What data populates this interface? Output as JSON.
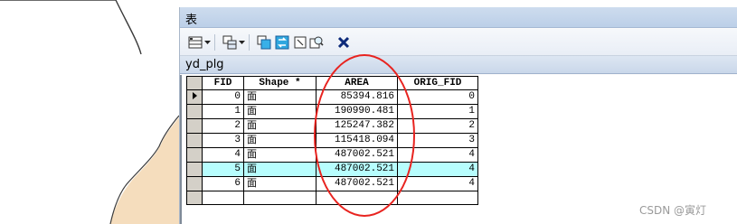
{
  "window": {
    "title": "表"
  },
  "toolbar": {
    "icons": [
      "table-options-icon",
      "related-tables-icon",
      "select-by-attributes-icon",
      "switch-selection-icon",
      "clear-selection-icon",
      "zoom-to-selected-icon",
      "delete-selected-icon"
    ]
  },
  "table": {
    "name": "yd_plg",
    "columns": [
      "FID",
      "Shape *",
      "AREA",
      "ORIG_FID"
    ],
    "rows": [
      {
        "fid": "0",
        "shape": "面",
        "area": "85394.816",
        "orig_fid": "0",
        "current": true,
        "highlighted": false
      },
      {
        "fid": "1",
        "shape": "面",
        "area": "190990.481",
        "orig_fid": "1",
        "current": false,
        "highlighted": false
      },
      {
        "fid": "2",
        "shape": "面",
        "area": "125247.382",
        "orig_fid": "2",
        "current": false,
        "highlighted": false
      },
      {
        "fid": "3",
        "shape": "面",
        "area": "115418.094",
        "orig_fid": "3",
        "current": false,
        "highlighted": false
      },
      {
        "fid": "4",
        "shape": "面",
        "area": "487002.521",
        "orig_fid": "4",
        "current": false,
        "highlighted": false
      },
      {
        "fid": "5",
        "shape": "面",
        "area": "487002.521",
        "orig_fid": "4",
        "current": false,
        "highlighted": true
      },
      {
        "fid": "6",
        "shape": "面",
        "area": "487002.521",
        "orig_fid": "4",
        "current": false,
        "highlighted": false
      }
    ]
  },
  "colors": {
    "highlight_row": "#b7fdfd",
    "annotation": "#e8231f",
    "titlebar": "#c4d5ec"
  },
  "watermark": "CSDN @寅灯"
}
